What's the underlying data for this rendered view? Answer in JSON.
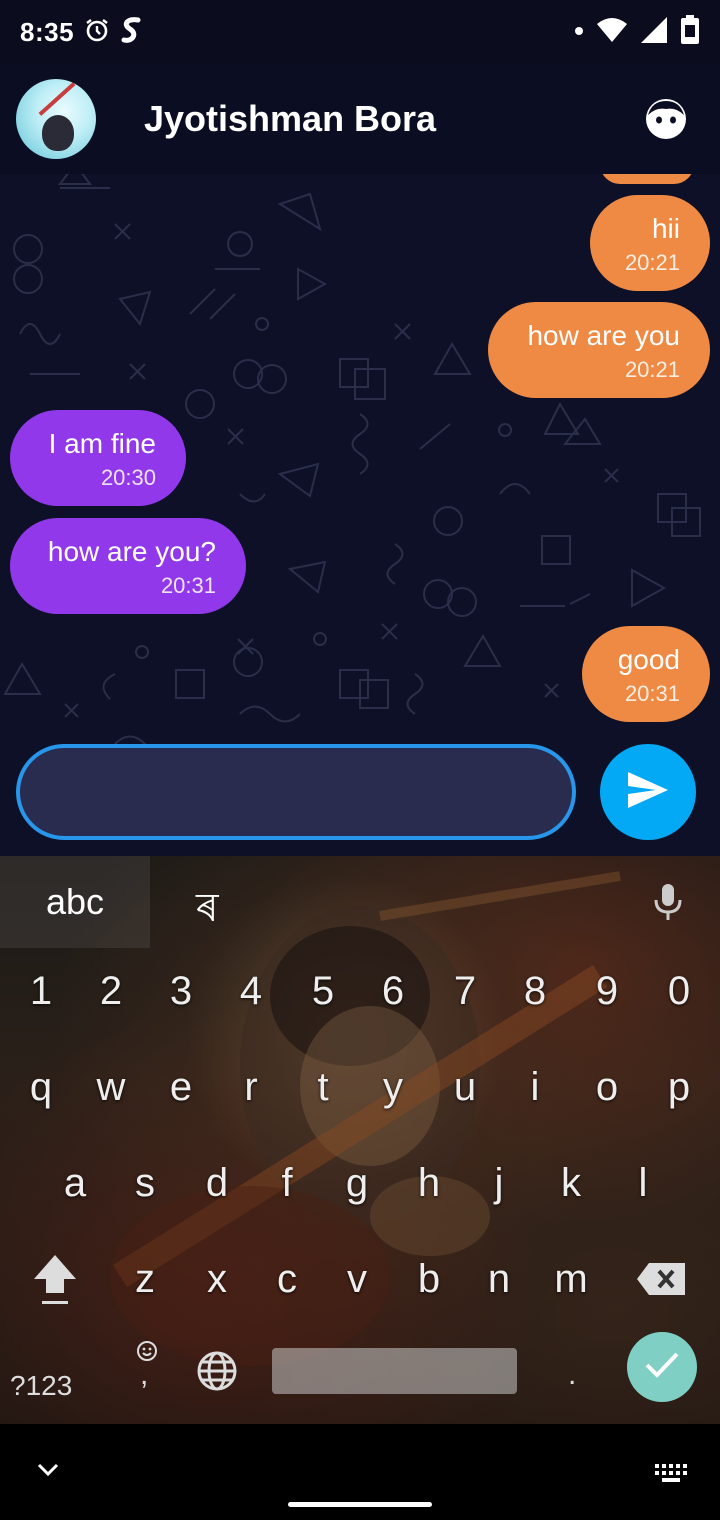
{
  "status_bar": {
    "time": "8:35",
    "icons": [
      "alarm-icon",
      "s-app-icon",
      "dot-icon",
      "wifi-icon",
      "signal-icon",
      "battery-icon"
    ]
  },
  "header": {
    "contact_name": "Jyotishman Bora",
    "avatar": "avatar",
    "action_icon": "face-icon"
  },
  "messages": [
    {
      "direction": "out",
      "text": "hii",
      "time": "20:21"
    },
    {
      "direction": "out",
      "text": "how are you",
      "time": "20:21"
    },
    {
      "direction": "in",
      "text": "I am fine",
      "time": "20:30"
    },
    {
      "direction": "in",
      "text": "how are you?",
      "time": "20:31"
    },
    {
      "direction": "out",
      "text": "good",
      "time": "20:31"
    }
  ],
  "composer": {
    "value": "",
    "send_icon": "send-icon"
  },
  "keyboard": {
    "tab_abc": "abc",
    "tab_bengali": "ৰ",
    "numbers": [
      "1",
      "2",
      "3",
      "4",
      "5",
      "6",
      "7",
      "8",
      "9",
      "0"
    ],
    "row1": [
      "q",
      "w",
      "e",
      "r",
      "t",
      "y",
      "u",
      "i",
      "o",
      "p"
    ],
    "row2": [
      "a",
      "s",
      "d",
      "f",
      "g",
      "h",
      "j",
      "k",
      "l"
    ],
    "row3": [
      "z",
      "x",
      "c",
      "v",
      "b",
      "n",
      "m"
    ],
    "symbols_label": "?123",
    "comma": ",",
    "period": "."
  },
  "colors": {
    "outgoing_bubble": "#ee8a43",
    "incoming_bubble": "#9139ea",
    "send_button": "#03a9f4",
    "input_border": "#2896ea",
    "done_button": "#7fcfc4"
  }
}
